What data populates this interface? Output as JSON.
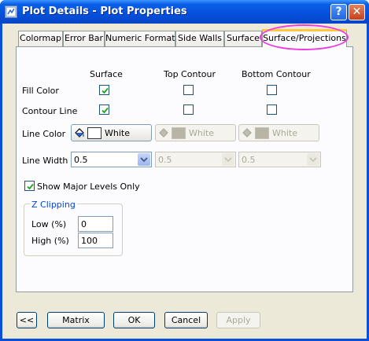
{
  "window": {
    "title": "Plot Details - Plot Properties",
    "help_label": "?",
    "close_label": "✕"
  },
  "tabs": [
    {
      "label": "Colormap"
    },
    {
      "label": "Error Bar"
    },
    {
      "label": "Numeric Formats"
    },
    {
      "label": "Side Walls"
    },
    {
      "label": "Surface"
    },
    {
      "label": "Surface/Projections"
    }
  ],
  "active_tab": "Surface/Projections",
  "highlight_color": "#ec3ce0",
  "columns": {
    "surface": "Surface",
    "top_contour": "Top Contour",
    "bottom_contour": "Bottom Contour"
  },
  "rows": {
    "fill_color": {
      "label": "Fill Color",
      "surface": true,
      "top": false,
      "bottom": false
    },
    "contour_line": {
      "label": "Contour Line",
      "surface": true,
      "top": false,
      "bottom": false
    }
  },
  "line_color": {
    "label": "Line Color",
    "surface": "White",
    "top": "White",
    "bottom": "White",
    "icon": "paint-bucket-icon"
  },
  "line_width": {
    "label": "Line Width",
    "surface": "0.5",
    "top": "0.5",
    "bottom": "0.5"
  },
  "show_major_levels": {
    "label": "Show Major Levels Only",
    "checked": true
  },
  "z_clipping": {
    "title": "Z Clipping",
    "low_label": "Low (%)",
    "low_value": "0",
    "high_label": "High (%)",
    "high_value": "100"
  },
  "buttons": {
    "back": "<<",
    "matrix": "Matrix",
    "ok": "OK",
    "cancel": "Cancel",
    "apply": "Apply"
  }
}
